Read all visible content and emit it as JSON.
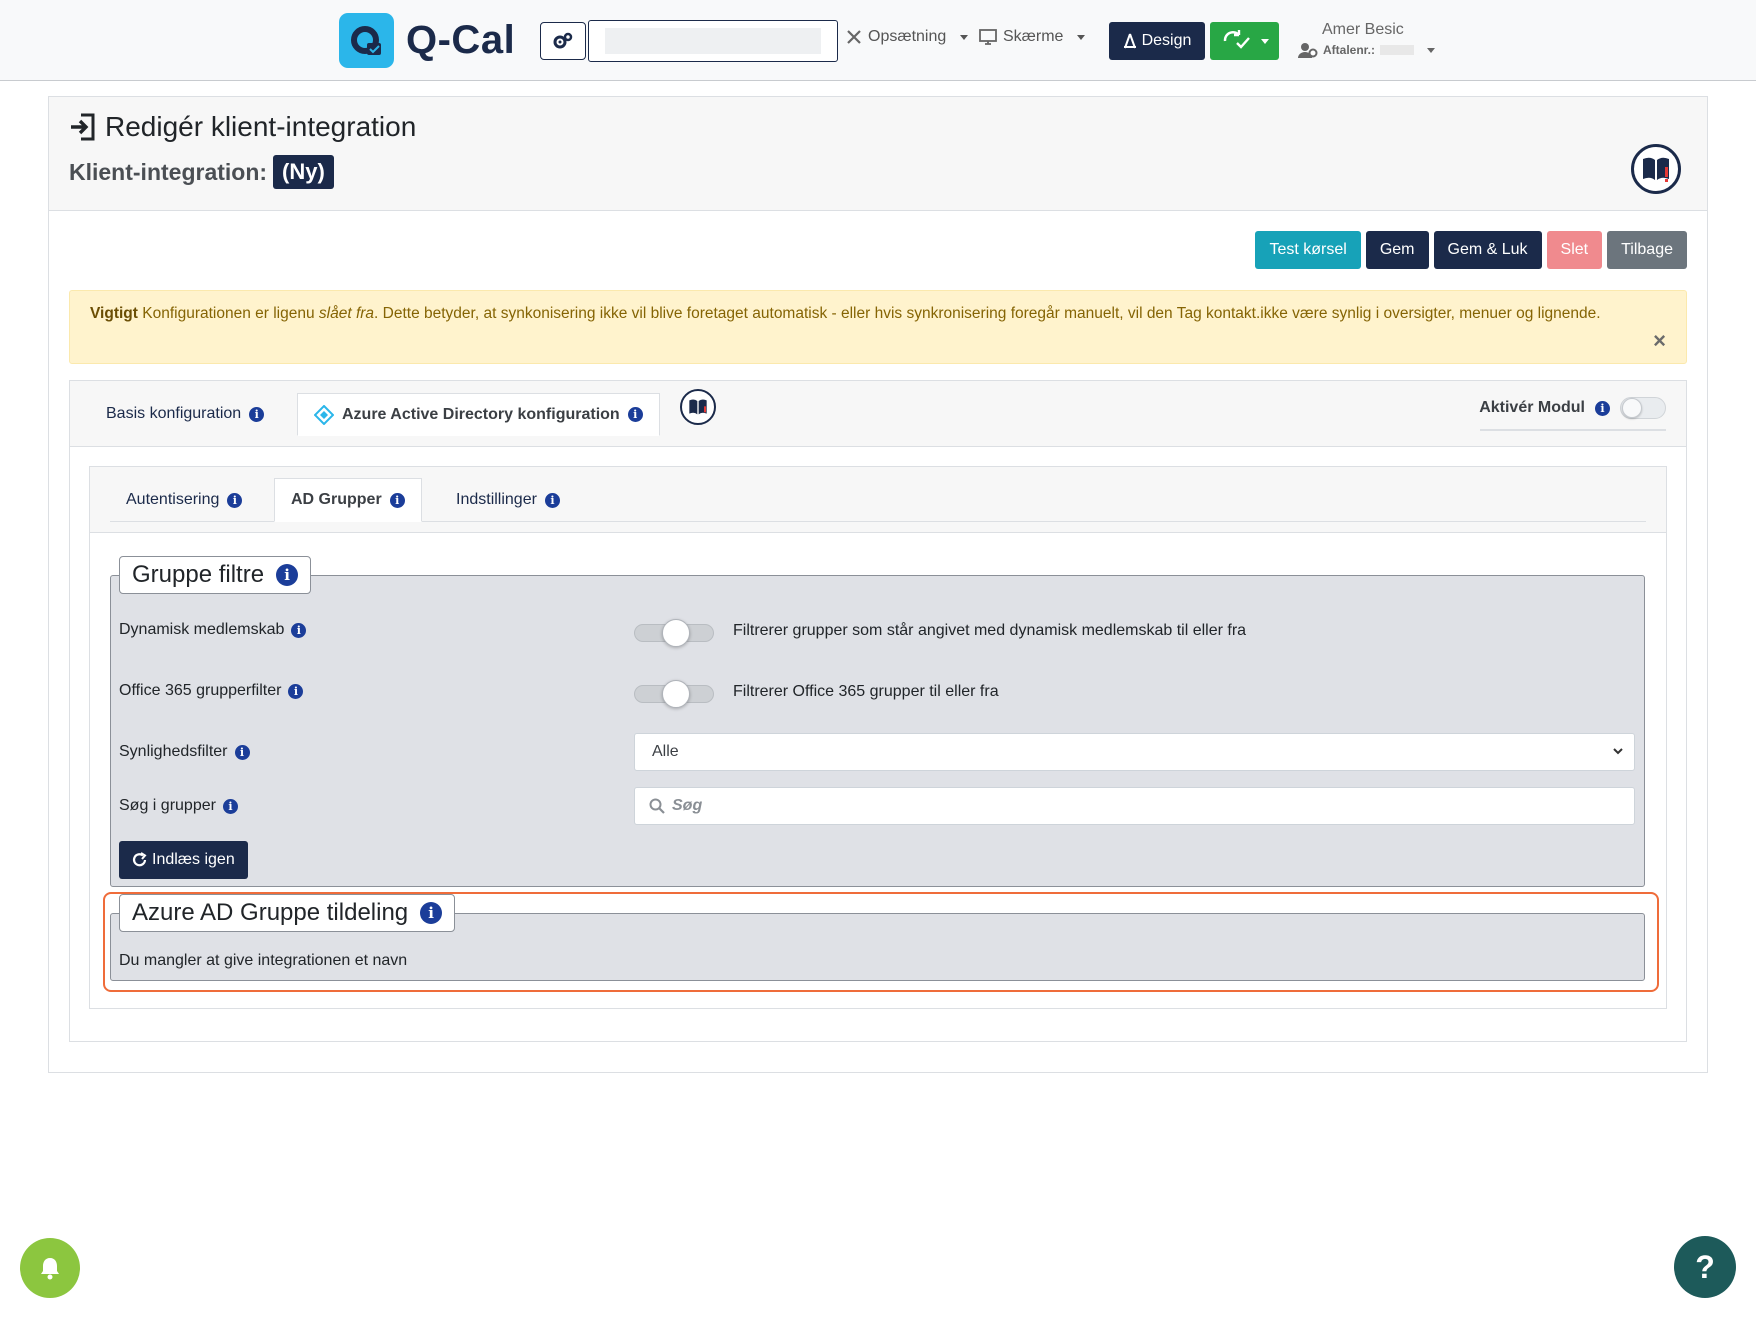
{
  "app": {
    "name": "Q-Cal"
  },
  "topbar": {
    "setup_label": "Opsætning",
    "screens_label": "Skærme",
    "design_label": "Design",
    "user_name": "Amer Besic",
    "agreement_label": "Aftalenr.:"
  },
  "page": {
    "title": "Redigér klient-integration",
    "subtitle_label": "Klient-integration:",
    "badge": "(Ny)"
  },
  "actions": {
    "test_run": "Test kørsel",
    "save": "Gem",
    "save_close": "Gem & Luk",
    "delete": "Slet",
    "back": "Tilbage"
  },
  "alert": {
    "strong": "Vigtigt",
    "text_before": " Konfigurationen er ligenu ",
    "emphasis": "slået fra",
    "text_after": ". Dette betyder, at synkonisering ikke vil blive foretaget automatisk - eller hvis synkronisering foregår manuelt, vil den Tag kontakt.ikke være synlig i oversigter, menuer og lignende.",
    "close": "×"
  },
  "main_tabs": {
    "basis": "Basis konfiguration",
    "azure": "Azure Active Directory konfiguration",
    "activate_label": "Aktivér Modul"
  },
  "inner_tabs": {
    "auth": "Autentisering",
    "groups": "AD Grupper",
    "settings": "Indstillinger"
  },
  "group_filters": {
    "legend": "Gruppe filtre",
    "dynamic_label": "Dynamisk medlemskab",
    "dynamic_desc": "Filtrerer grupper som står angivet med dynamisk medlemskab til eller fra",
    "office_label": "Office 365 grupperfilter",
    "office_desc": "Filtrerer Office 365 grupper til eller fra",
    "visibility_label": "Synlighedsfilter",
    "visibility_value": "Alle",
    "search_label": "Søg i grupper",
    "search_placeholder": "Søg",
    "reload_label": "Indlæs igen"
  },
  "assignment": {
    "legend": "Azure AD Gruppe tildeling",
    "message": "Du mangler at give integrationen et navn"
  },
  "colors": {
    "primary": "#1b2a4a",
    "info": "#17a2b8",
    "success": "#28a745",
    "warning_bg": "#fff3cd",
    "highlight": "#ef6c3a"
  }
}
